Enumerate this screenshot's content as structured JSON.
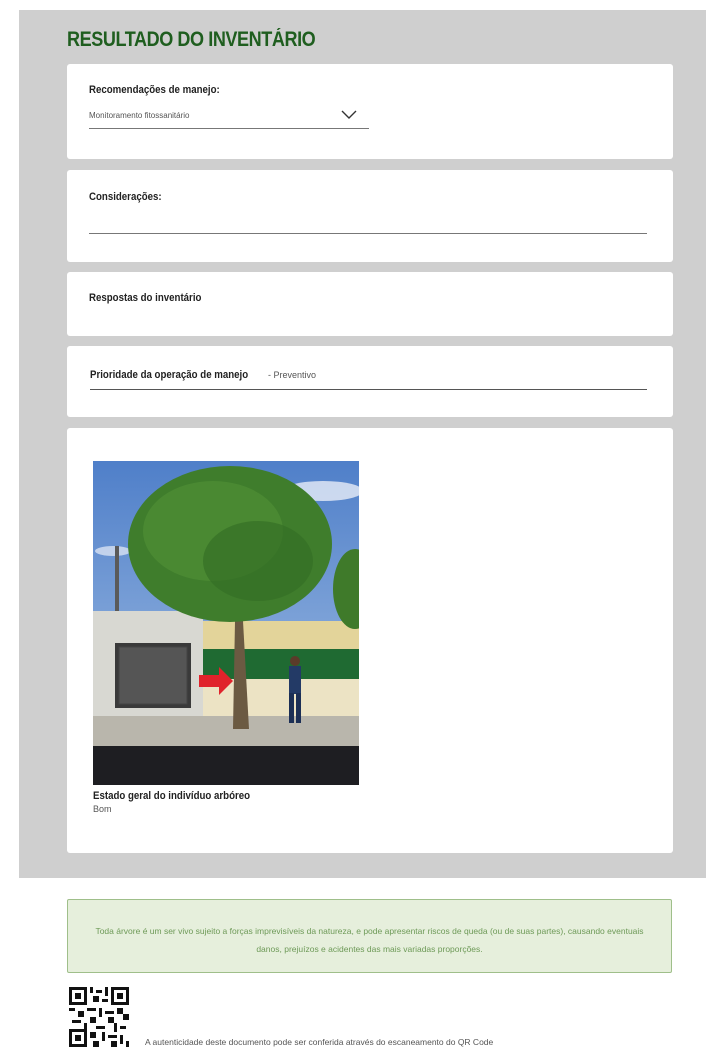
{
  "header": {
    "title": "RESULTADO DO INVENTÁRIO"
  },
  "management": {
    "label": "Recomendações de manejo:",
    "selected": "Monitoramento fitossanitário",
    "icon": "chevron-down-icon"
  },
  "considerations": {
    "label": "Considerações:",
    "value": ""
  },
  "responses": {
    "label": "Respostas do inventário"
  },
  "priority": {
    "label": "Prioridade da operação de manejo",
    "value": "- Preventivo"
  },
  "photo": {
    "caption": "Estado geral do indivíduo arbóreo",
    "value": "Bom"
  },
  "footer": {
    "notice": "Toda árvore é um ser vivo sujeito a forças imprevisíveis da natureza, e pode apresentar riscos de queda (ou de suas partes), causando eventuais danos, prejuízos e acidentes das mais variadas proporções.",
    "authenticity": "A autenticidade deste documento pode ser conferida através do escaneamento do QR Code"
  },
  "colors": {
    "title": "#1f5e1f",
    "background": "#cfcfcf",
    "notice_bg": "#e6efdc",
    "notice_text": "#6e9a58"
  }
}
